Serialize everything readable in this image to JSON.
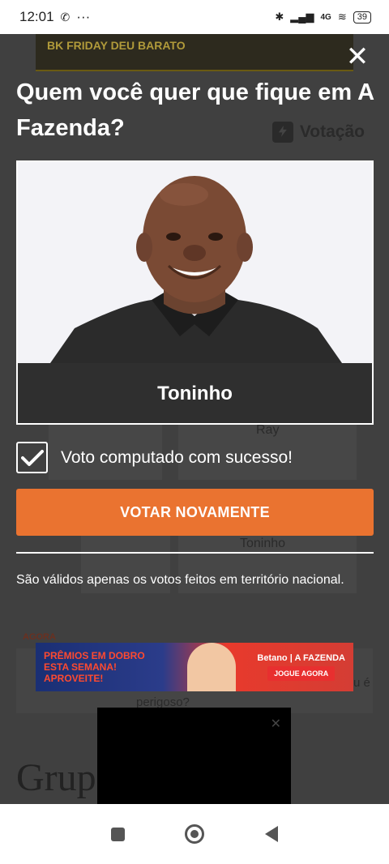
{
  "status_bar": {
    "time": "12:01",
    "icons": [
      "whatsapp-icon",
      "more-icon",
      "bluetooth-icon",
      "signal-icon",
      "wifi-icon"
    ],
    "network": "4G",
    "battery": "39"
  },
  "background_page": {
    "ad_top_text": "BK FRIDAY DEU BARATO",
    "ghost_names": [
      "Ray",
      "Toninho"
    ],
    "section_label": "AGORA",
    "snippet_end": "u é",
    "snippet_line": "perigoso?",
    "headline": "Grup                r de"
  },
  "modal": {
    "question": "Quem você quer que fique em A Fazenda?",
    "tag": "Votação",
    "candidate_name": "Toninho",
    "success_message": "Voto computado com sucesso!",
    "vote_again_label": "VOTAR NOVAMENTE",
    "disclaimer": "São válidos apenas os votos feitos em território nacional."
  },
  "ad_bottom": {
    "promo": "PRÊMIOS EM DOBRO ESTA SEMANA! APROVEITE!",
    "brand": "Betano | A FAZENDA",
    "cta": "JOGUE AGORA"
  },
  "colors": {
    "accent": "#ea7330",
    "overlay": "#3a3a3a",
    "name_bar": "#2f2f2f"
  }
}
